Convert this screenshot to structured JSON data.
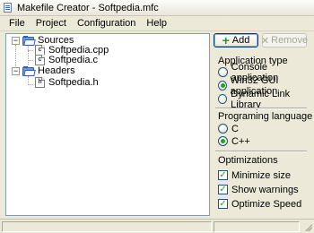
{
  "window": {
    "title": "Makefile Creator - Softpedia.mfc"
  },
  "menu": [
    "File",
    "Project",
    "Configuration",
    "Help"
  ],
  "tree": {
    "sources_label": "Sources",
    "sources_files": [
      "Softpedia.cpp",
      "Softpedia.c"
    ],
    "headers_label": "Headers",
    "headers_files": [
      "Softpedia.h"
    ]
  },
  "toolbar": {
    "add_label": "Add",
    "remove_label": "Remove"
  },
  "app_type": {
    "label": "Application type",
    "options": [
      "Console application",
      "Win32 GUI application",
      "Dynamic Link Library"
    ],
    "selected": "Win32 GUI application"
  },
  "language": {
    "label": "Programing language",
    "options": [
      "C",
      "C++"
    ],
    "selected": "C++"
  },
  "optimizations": {
    "label": "Optimizations",
    "options": [
      "Minimize size",
      "Show warnings",
      "Optimize Speed"
    ],
    "checked": [
      true,
      true,
      true
    ]
  },
  "colors": {
    "accent_check": "#21a121",
    "folder": "#2a5fbf"
  }
}
